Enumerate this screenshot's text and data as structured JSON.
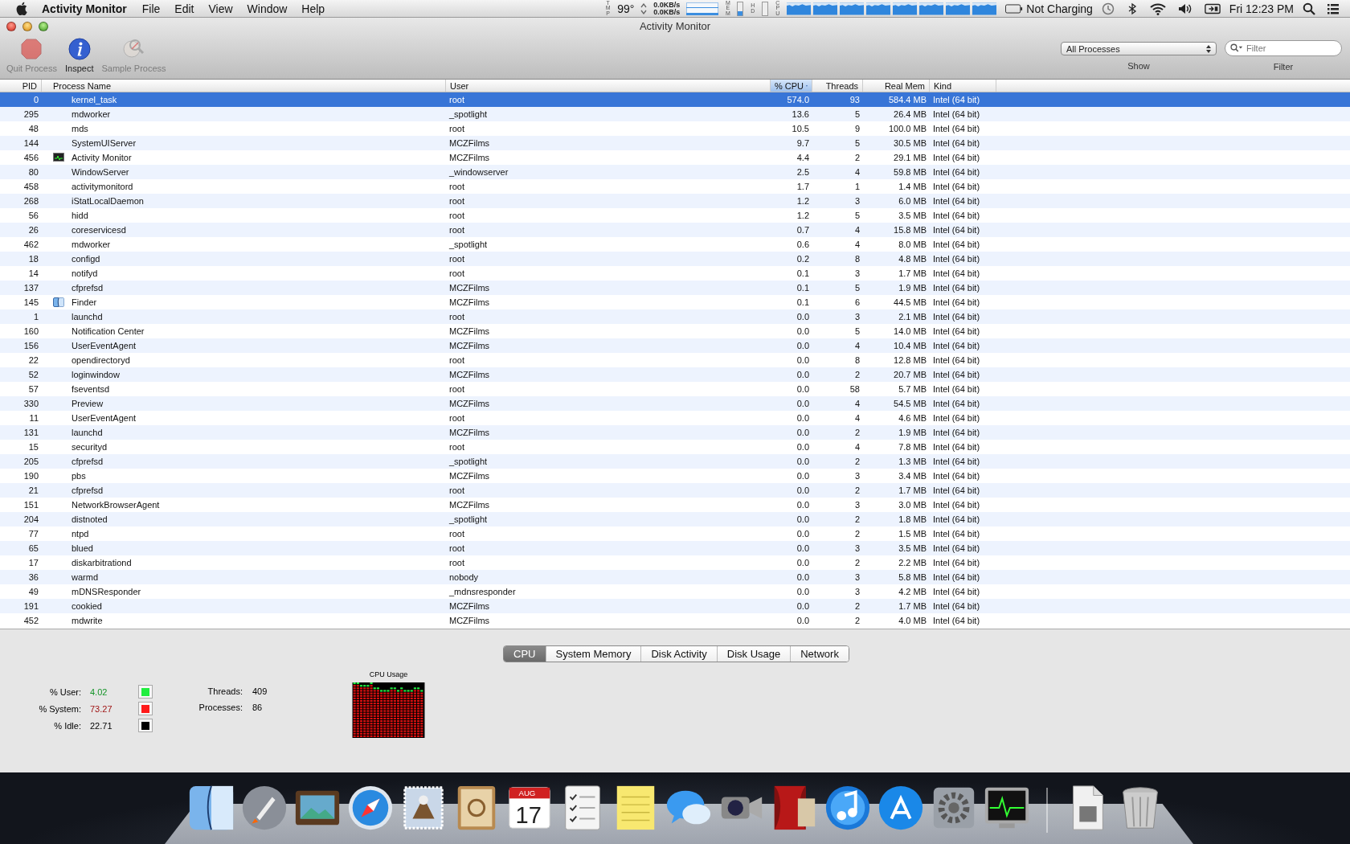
{
  "menu_bar": {
    "app_name": "Activity Monitor",
    "menus": [
      "File",
      "Edit",
      "View",
      "Window",
      "Help"
    ],
    "temperature": {
      "label": "TMP",
      "value": "99°"
    },
    "network": [
      "0.0KB/s",
      "0.0KB/s"
    ],
    "meters": [
      "MEM",
      "HD",
      "CPU"
    ],
    "battery": "Not Charging",
    "clock": "Fri 12:23 PM"
  },
  "window": {
    "title": "Activity Monitor"
  },
  "toolbar": {
    "buttons": [
      {
        "label": "Quit Process",
        "disabled": true
      },
      {
        "label": "Inspect",
        "disabled": false
      },
      {
        "label": "Sample Process",
        "disabled": true
      }
    ],
    "show": {
      "value": "All Processes",
      "label": "Show"
    },
    "filter": {
      "placeholder": "Filter",
      "label": "Filter"
    }
  },
  "table": {
    "columns": [
      {
        "label": "PID",
        "sorted": false
      },
      {
        "label": "Process Name",
        "sorted": false
      },
      {
        "label": "User",
        "sorted": false
      },
      {
        "label": "% CPU",
        "sorted": true
      },
      {
        "label": "Threads",
        "sorted": false
      },
      {
        "label": "Real Mem",
        "sorted": false
      },
      {
        "label": "Kind",
        "sorted": false
      }
    ],
    "rows": [
      {
        "pid": "0",
        "name": "kernel_task",
        "user": "root",
        "cpu": "574.0",
        "threads": "93",
        "mem": "584.4 MB",
        "kind": "Intel (64 bit)",
        "selected": true
      },
      {
        "pid": "295",
        "name": "mdworker",
        "user": "_spotlight",
        "cpu": "13.6",
        "threads": "5",
        "mem": "26.4 MB",
        "kind": "Intel (64 bit)",
        "selected": false
      },
      {
        "pid": "48",
        "name": "mds",
        "user": "root",
        "cpu": "10.5",
        "threads": "9",
        "mem": "100.0 MB",
        "kind": "Intel (64 bit)",
        "selected": false
      },
      {
        "pid": "144",
        "name": "SystemUIServer",
        "user": "MCZFilms",
        "cpu": "9.7",
        "threads": "5",
        "mem": "30.5 MB",
        "kind": "Intel (64 bit)",
        "selected": false
      },
      {
        "pid": "456",
        "name": "Activity Monitor",
        "user": "MCZFilms",
        "cpu": "4.4",
        "threads": "2",
        "mem": "29.1 MB",
        "kind": "Intel (64 bit)",
        "selected": false
      },
      {
        "pid": "80",
        "name": "WindowServer",
        "user": "_windowserver",
        "cpu": "2.5",
        "threads": "4",
        "mem": "59.8 MB",
        "kind": "Intel (64 bit)",
        "selected": false
      },
      {
        "pid": "458",
        "name": "activitymonitord",
        "user": "root",
        "cpu": "1.7",
        "threads": "1",
        "mem": "1.4 MB",
        "kind": "Intel (64 bit)",
        "selected": false
      },
      {
        "pid": "268",
        "name": "iStatLocalDaemon",
        "user": "root",
        "cpu": "1.2",
        "threads": "3",
        "mem": "6.0 MB",
        "kind": "Intel (64 bit)",
        "selected": false
      },
      {
        "pid": "56",
        "name": "hidd",
        "user": "root",
        "cpu": "1.2",
        "threads": "5",
        "mem": "3.5 MB",
        "kind": "Intel (64 bit)",
        "selected": false
      },
      {
        "pid": "26",
        "name": "coreservicesd",
        "user": "root",
        "cpu": "0.7",
        "threads": "4",
        "mem": "15.8 MB",
        "kind": "Intel (64 bit)",
        "selected": false
      },
      {
        "pid": "462",
        "name": "mdworker",
        "user": "_spotlight",
        "cpu": "0.6",
        "threads": "4",
        "mem": "8.0 MB",
        "kind": "Intel (64 bit)",
        "selected": false
      },
      {
        "pid": "18",
        "name": "configd",
        "user": "root",
        "cpu": "0.2",
        "threads": "8",
        "mem": "4.8 MB",
        "kind": "Intel (64 bit)",
        "selected": false
      },
      {
        "pid": "14",
        "name": "notifyd",
        "user": "root",
        "cpu": "0.1",
        "threads": "3",
        "mem": "1.7 MB",
        "kind": "Intel (64 bit)",
        "selected": false
      },
      {
        "pid": "137",
        "name": "cfprefsd",
        "user": "MCZFilms",
        "cpu": "0.1",
        "threads": "5",
        "mem": "1.9 MB",
        "kind": "Intel (64 bit)",
        "selected": false
      },
      {
        "pid": "145",
        "name": "Finder",
        "user": "MCZFilms",
        "cpu": "0.1",
        "threads": "6",
        "mem": "44.5 MB",
        "kind": "Intel (64 bit)",
        "selected": false
      },
      {
        "pid": "1",
        "name": "launchd",
        "user": "root",
        "cpu": "0.0",
        "threads": "3",
        "mem": "2.1 MB",
        "kind": "Intel (64 bit)",
        "selected": false
      },
      {
        "pid": "160",
        "name": "Notification Center",
        "user": "MCZFilms",
        "cpu": "0.0",
        "threads": "5",
        "mem": "14.0 MB",
        "kind": "Intel (64 bit)",
        "selected": false
      },
      {
        "pid": "156",
        "name": "UserEventAgent",
        "user": "MCZFilms",
        "cpu": "0.0",
        "threads": "4",
        "mem": "10.4 MB",
        "kind": "Intel (64 bit)",
        "selected": false
      },
      {
        "pid": "22",
        "name": "opendirectoryd",
        "user": "root",
        "cpu": "0.0",
        "threads": "8",
        "mem": "12.8 MB",
        "kind": "Intel (64 bit)",
        "selected": false
      },
      {
        "pid": "52",
        "name": "loginwindow",
        "user": "MCZFilms",
        "cpu": "0.0",
        "threads": "2",
        "mem": "20.7 MB",
        "kind": "Intel (64 bit)",
        "selected": false
      },
      {
        "pid": "57",
        "name": "fseventsd",
        "user": "root",
        "cpu": "0.0",
        "threads": "58",
        "mem": "5.7 MB",
        "kind": "Intel (64 bit)",
        "selected": false
      },
      {
        "pid": "330",
        "name": "Preview",
        "user": "MCZFilms",
        "cpu": "0.0",
        "threads": "4",
        "mem": "54.5 MB",
        "kind": "Intel (64 bit)",
        "selected": false
      },
      {
        "pid": "11",
        "name": "UserEventAgent",
        "user": "root",
        "cpu": "0.0",
        "threads": "4",
        "mem": "4.6 MB",
        "kind": "Intel (64 bit)",
        "selected": false
      },
      {
        "pid": "131",
        "name": "launchd",
        "user": "MCZFilms",
        "cpu": "0.0",
        "threads": "2",
        "mem": "1.9 MB",
        "kind": "Intel (64 bit)",
        "selected": false
      },
      {
        "pid": "15",
        "name": "securityd",
        "user": "root",
        "cpu": "0.0",
        "threads": "4",
        "mem": "7.8 MB",
        "kind": "Intel (64 bit)",
        "selected": false
      },
      {
        "pid": "205",
        "name": "cfprefsd",
        "user": "_spotlight",
        "cpu": "0.0",
        "threads": "2",
        "mem": "1.3 MB",
        "kind": "Intel (64 bit)",
        "selected": false
      },
      {
        "pid": "190",
        "name": "pbs",
        "user": "MCZFilms",
        "cpu": "0.0",
        "threads": "3",
        "mem": "3.4 MB",
        "kind": "Intel (64 bit)",
        "selected": false
      },
      {
        "pid": "21",
        "name": "cfprefsd",
        "user": "root",
        "cpu": "0.0",
        "threads": "2",
        "mem": "1.7 MB",
        "kind": "Intel (64 bit)",
        "selected": false
      },
      {
        "pid": "151",
        "name": "NetworkBrowserAgent",
        "user": "MCZFilms",
        "cpu": "0.0",
        "threads": "3",
        "mem": "3.0 MB",
        "kind": "Intel (64 bit)",
        "selected": false
      },
      {
        "pid": "204",
        "name": "distnoted",
        "user": "_spotlight",
        "cpu": "0.0",
        "threads": "2",
        "mem": "1.8 MB",
        "kind": "Intel (64 bit)",
        "selected": false
      },
      {
        "pid": "77",
        "name": "ntpd",
        "user": "root",
        "cpu": "0.0",
        "threads": "2",
        "mem": "1.5 MB",
        "kind": "Intel (64 bit)",
        "selected": false
      },
      {
        "pid": "65",
        "name": "blued",
        "user": "root",
        "cpu": "0.0",
        "threads": "3",
        "mem": "3.5 MB",
        "kind": "Intel (64 bit)",
        "selected": false
      },
      {
        "pid": "17",
        "name": "diskarbitrationd",
        "user": "root",
        "cpu": "0.0",
        "threads": "2",
        "mem": "2.2 MB",
        "kind": "Intel (64 bit)",
        "selected": false
      },
      {
        "pid": "36",
        "name": "warmd",
        "user": "nobody",
        "cpu": "0.0",
        "threads": "3",
        "mem": "5.8 MB",
        "kind": "Intel (64 bit)",
        "selected": false
      },
      {
        "pid": "49",
        "name": "mDNSResponder",
        "user": "_mdnsresponder",
        "cpu": "0.0",
        "threads": "3",
        "mem": "4.2 MB",
        "kind": "Intel (64 bit)",
        "selected": false
      },
      {
        "pid": "191",
        "name": "cookied",
        "user": "MCZFilms",
        "cpu": "0.0",
        "threads": "2",
        "mem": "1.7 MB",
        "kind": "Intel (64 bit)",
        "selected": false
      },
      {
        "pid": "452",
        "name": "mdwrite",
        "user": "MCZFilms",
        "cpu": "0.0",
        "threads": "2",
        "mem": "4.0 MB",
        "kind": "Intel (64 bit)",
        "selected": false
      }
    ]
  },
  "bottom_tabs": [
    {
      "label": "CPU",
      "selected": true
    },
    {
      "label": "System Memory",
      "selected": false
    },
    {
      "label": "Disk Activity",
      "selected": false
    },
    {
      "label": "Disk Usage",
      "selected": false
    },
    {
      "label": "Network",
      "selected": false
    }
  ],
  "cpu_stats": [
    {
      "label": "% User:",
      "value": "4.02",
      "color": "#20ee40"
    },
    {
      "label": "% System:",
      "value": "73.27",
      "color": "#ff1a1a"
    },
    {
      "label": "% Idle:",
      "value": "22.71",
      "color": "#000000"
    }
  ],
  "counts": [
    {
      "label": "Threads:",
      "value": "409"
    },
    {
      "label": "Processes:",
      "value": "86"
    }
  ],
  "cpu_graph": {
    "title": "CPU Usage"
  },
  "dock": {
    "calendar": {
      "month": "AUG",
      "day": "17"
    }
  }
}
